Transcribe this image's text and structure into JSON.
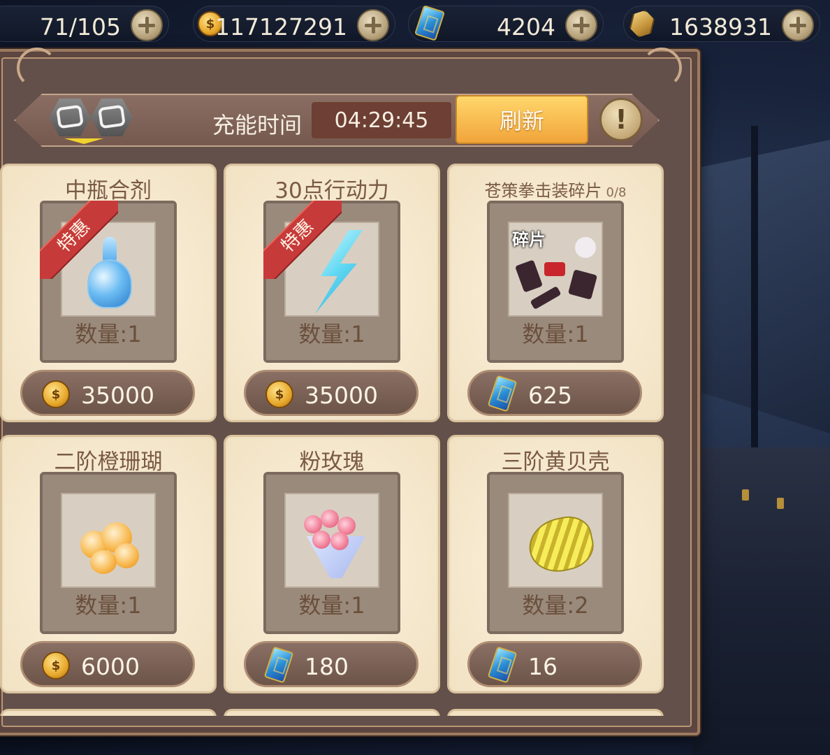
{
  "resources": [
    {
      "icon": "stamina-icon",
      "value": "71/105"
    },
    {
      "icon": "gold-coin-icon",
      "value": "117127291"
    },
    {
      "icon": "blue-gem-icon",
      "value": "4204"
    },
    {
      "icon": "gold-token-icon",
      "value": "1638931"
    }
  ],
  "coin_glyph": "$",
  "header": {
    "charge_label": "充能时间",
    "charge_time": "04:29:45",
    "refresh_label": "刷新",
    "info_label": "!"
  },
  "items": [
    {
      "name": "中瓶合剂",
      "qty": "数量:1",
      "price": "35000",
      "currency": "gold-coin",
      "badge": "特惠"
    },
    {
      "name": "30点行动力",
      "qty": "数量:1",
      "price": "35000",
      "currency": "gold-coin",
      "badge": "特惠"
    },
    {
      "name": "苍策拳击装碎片",
      "progress": "0/8",
      "qty": "数量:1",
      "price": "625",
      "currency": "blue-gem",
      "tag": "碎片"
    },
    {
      "name": "二阶橙珊瑚",
      "qty": "数量:1",
      "price": "6000",
      "currency": "gold-coin"
    },
    {
      "name": "粉玫瑰",
      "qty": "数量:1",
      "price": "180",
      "currency": "blue-gem"
    },
    {
      "name": "三阶黄贝壳",
      "qty": "数量:2",
      "price": "16",
      "currency": "blue-gem"
    }
  ],
  "colors": {
    "panel": "#5d4540",
    "card": "#f6e8cd",
    "refresh": "#f1a43a",
    "ribbon": "#c73a3a"
  }
}
